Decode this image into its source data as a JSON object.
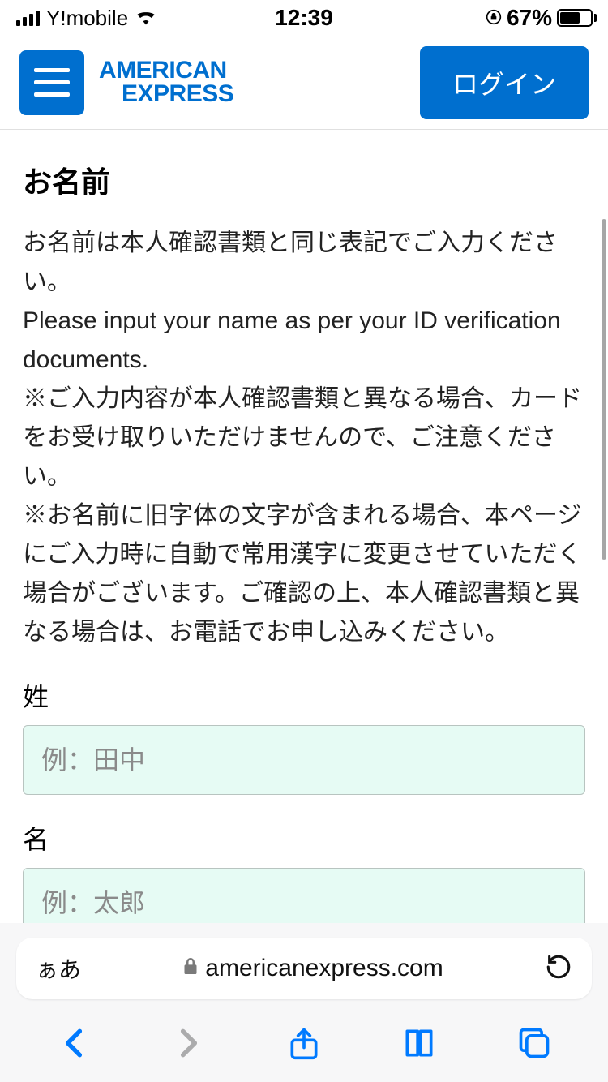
{
  "status": {
    "carrier": "Y!mobile",
    "time": "12:39",
    "battery_pct": "67%",
    "battery_fill": 67
  },
  "header": {
    "logo_line1": "AMERICAN",
    "logo_line2": "EXPRESS",
    "login_label": "ログイン"
  },
  "form": {
    "section_title": "お名前",
    "instr_jp": "お名前は本人確認書類と同じ表記でご入力ください。",
    "instr_en": "Please input your name as per your ID verification documents.",
    "note1": "※ご入力内容が本人確認書類と異なる場合、カードをお受け取りいただけませんので、ご注意ください。",
    "note2": "※お名前に旧字体の文字が含まれる場合、本ページにご入力時に自動で常用漢字に変更させていただく場合がございます。ご確認の上、本人確認書類と異なる場合は、お電話でお申し込みください。",
    "last_name_label": "姓",
    "last_name_placeholder": "例：田中",
    "first_name_label": "名",
    "first_name_placeholder": "例：太郎"
  },
  "browser": {
    "aa": "ぁあ",
    "domain": "americanexpress.com"
  }
}
